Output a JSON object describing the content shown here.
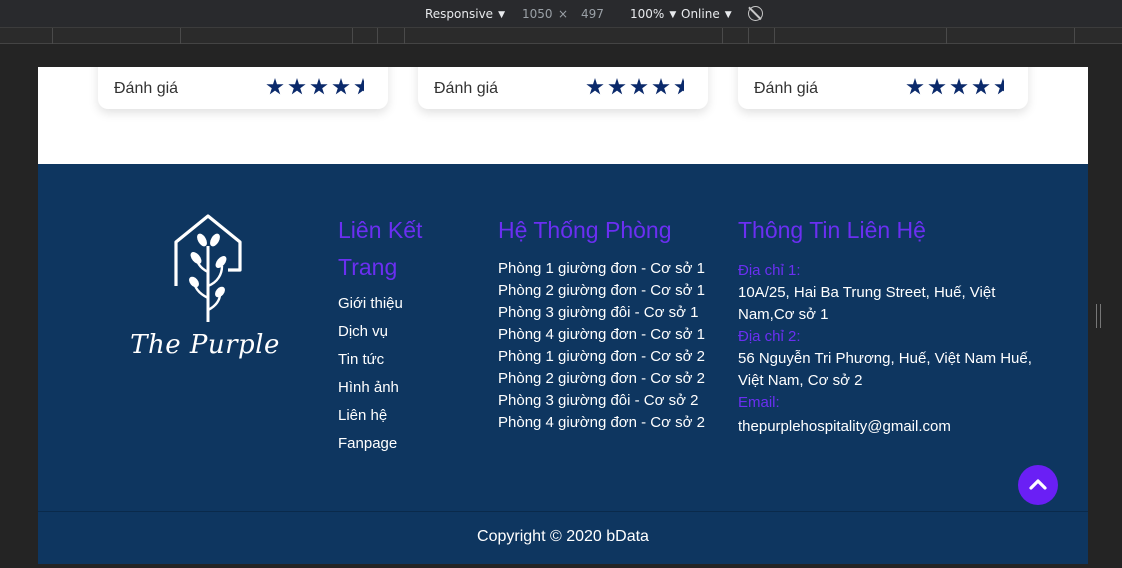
{
  "devtools": {
    "device": "Responsive",
    "width": "1050",
    "times": "×",
    "height": "497",
    "zoom": "100%",
    "network": "Online"
  },
  "cards": [
    {
      "label": "Đánh giá",
      "rating": 4.5
    },
    {
      "label": "Đánh giá",
      "rating": 4.5
    },
    {
      "label": "Đánh giá",
      "rating": 4.5
    }
  ],
  "footer": {
    "logo_text": "The Purple",
    "links": {
      "title_line1": "Liên Kết",
      "title_line2": "Trang",
      "items": [
        "Giới thiệu",
        "Dịch vụ",
        "Tin tức",
        "Hình ảnh",
        "Liên hệ",
        "Fanpage"
      ]
    },
    "rooms": {
      "title": "Hệ Thống Phòng",
      "items": [
        "Phòng 1 giường đơn - Cơ sở 1",
        "Phòng 2 giường đơn - Cơ sở 1",
        "Phòng 3 giường đôi - Cơ sở 1",
        "Phòng 4 giường đơn - Cơ sở 1",
        "Phòng 1 giường đơn - Cơ sở 2",
        "Phòng 2 giường đơn - Cơ sở 2",
        "Phòng 3 giường đôi - Cơ sở 2",
        "Phòng 4 giường đơn - Cơ sở 2"
      ]
    },
    "contact": {
      "title": "Thông Tin Liên Hệ",
      "address1_label": "Địa chỉ 1:",
      "address1_line1": "10A/25, Hai Ba Trung Street, Huế, Việt",
      "address1_line2": "Nam,Cơ sở 1",
      "address2_label": "Địa chỉ 2:",
      "address2_line1": "56 Nguyễn Tri Phương, Huế, Việt Nam Huế,",
      "address2_line2": "Việt Nam, Cơ sở 2",
      "email_label": "Email:",
      "email": "thepurplehospitality@gmail.com"
    },
    "copyright": "Copyright © 2020 bData"
  },
  "colors": {
    "footer_bg": "#0e3660",
    "accent": "#6b2ff2",
    "star": "#0b2a6b"
  },
  "icons": [
    "rotate-icon",
    "star-icon",
    "chevron-up-icon",
    "house-tree-logo-icon"
  ]
}
